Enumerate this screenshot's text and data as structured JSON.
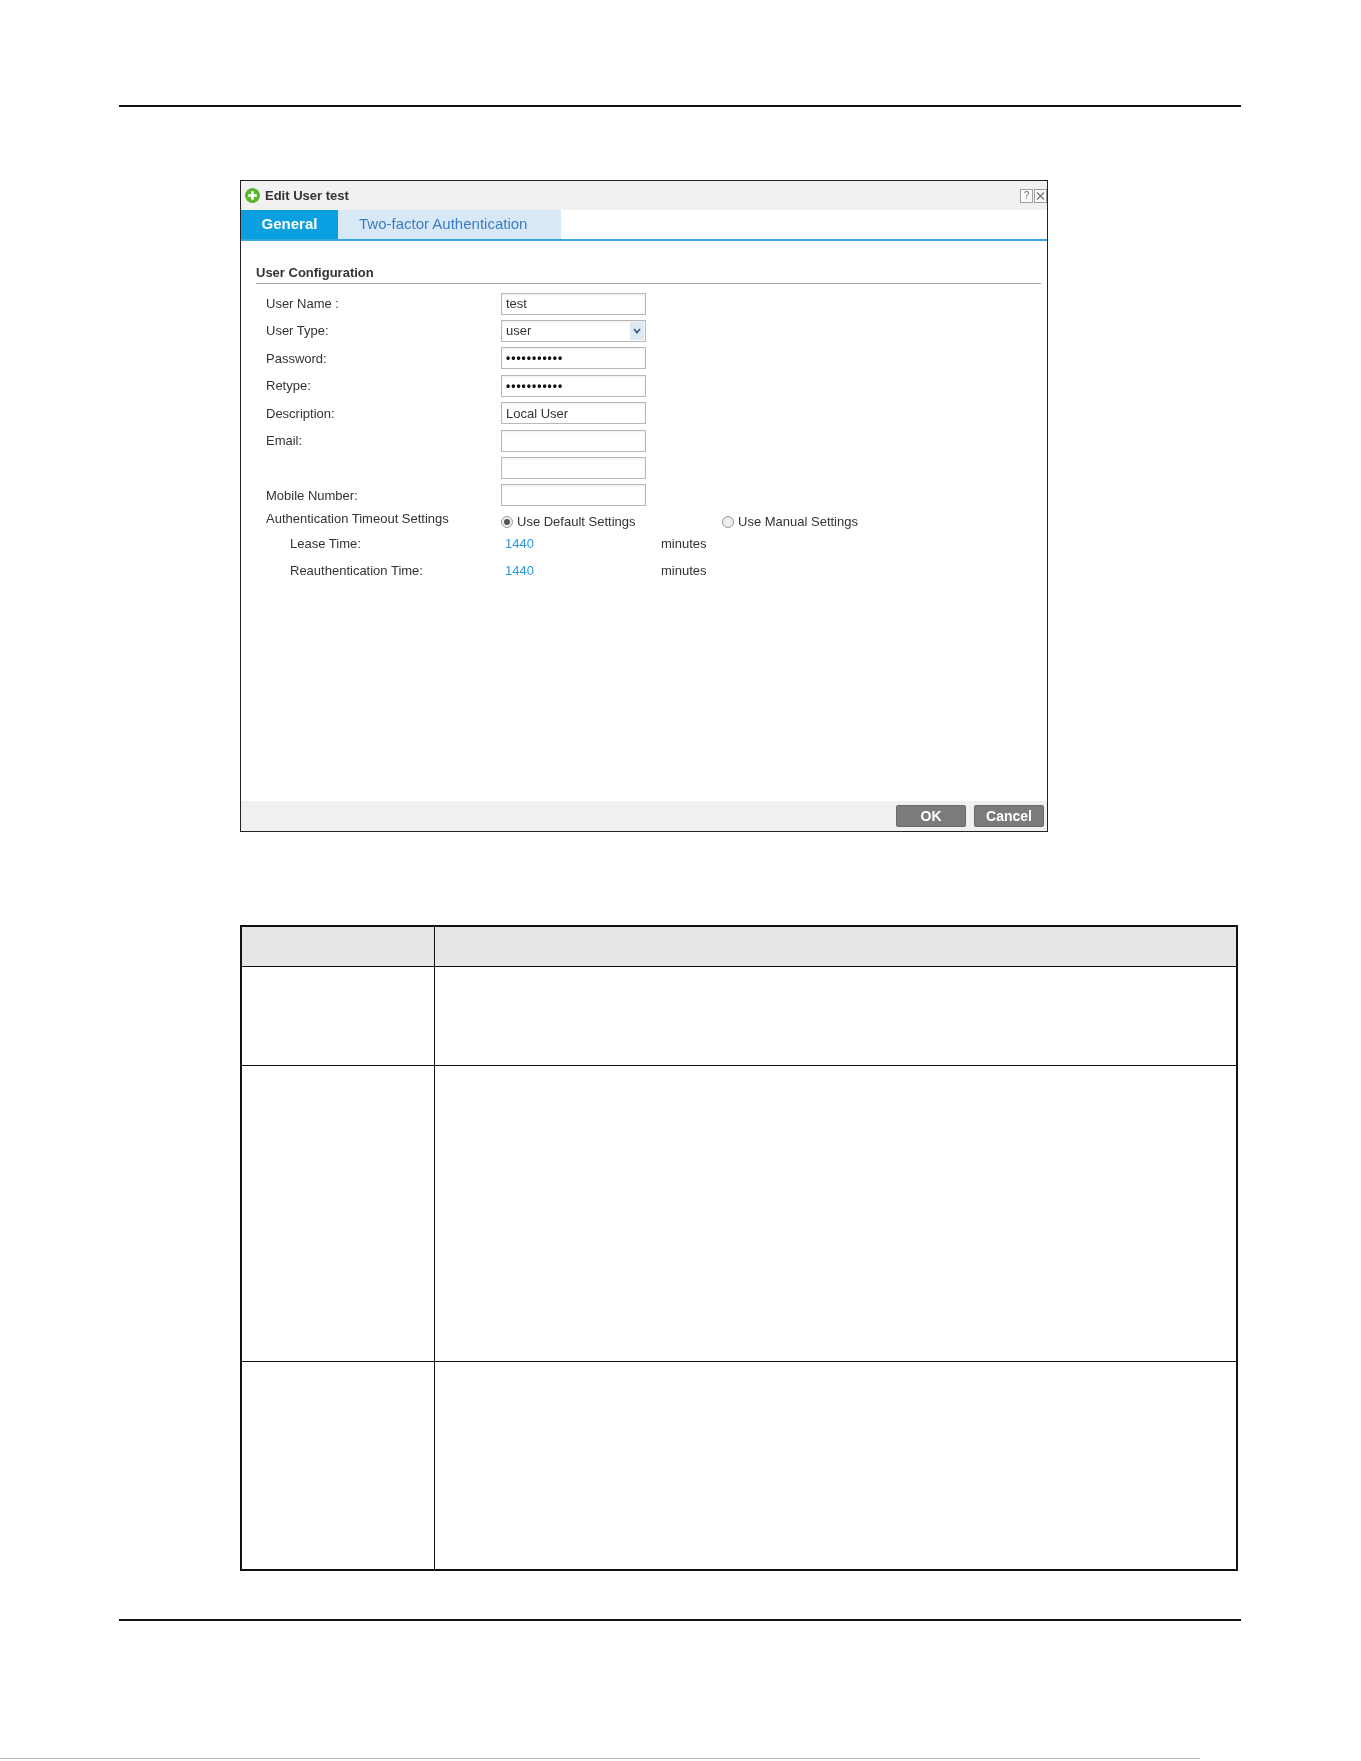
{
  "dialog": {
    "title": "Edit User test",
    "help": "?"
  },
  "tabs": [
    {
      "label": "General",
      "selected": true
    },
    {
      "label": "Two-factor Authentication",
      "selected": false
    }
  ],
  "section_title": "User Configuration",
  "fields": [
    {
      "kind": "text",
      "label": "User Name :",
      "value": "test"
    },
    {
      "kind": "select",
      "label": "User Type:",
      "value": "user"
    },
    {
      "kind": "password",
      "label": "Password:",
      "value": "•••••••••••"
    },
    {
      "kind": "password",
      "label": "Retype:",
      "value": "•••••••••••"
    },
    {
      "kind": "text",
      "label": "Description:",
      "value": "Local User"
    },
    {
      "kind": "text",
      "label": "Email:"
    },
    {
      "kind": "text"
    },
    {
      "kind": "text",
      "label": "Mobile Number:"
    }
  ],
  "timeout": {
    "label": "Authentication Timeout Settings",
    "options": [
      {
        "label": "Use Default Settings",
        "selected": true
      },
      {
        "label": "Use Manual Settings",
        "selected": false
      }
    ],
    "rows": [
      {
        "label": "Lease Time:",
        "value": "1440",
        "unit": "minutes"
      },
      {
        "label": "Reauthentication Time:",
        "value": "1440",
        "unit": "minutes"
      }
    ]
  },
  "buttons": [
    "OK",
    "Cancel"
  ]
}
